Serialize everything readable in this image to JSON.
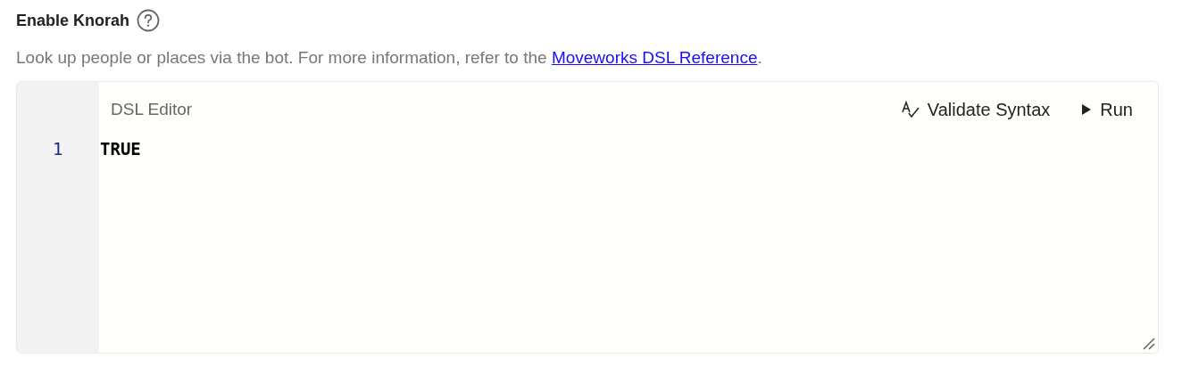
{
  "title": "Enable Knorah",
  "description": {
    "text": "Look up people or places via the bot. For more information, refer to the ",
    "link": "Moveworks DSL Reference",
    "after": "."
  },
  "editor": {
    "label": "DSL Editor",
    "actions": [
      {
        "kind": "validate",
        "label": "Validate Syntax"
      },
      {
        "kind": "run",
        "label": "Run"
      }
    ],
    "lines": [
      {
        "number": "1",
        "code": "TRUE"
      }
    ]
  }
}
